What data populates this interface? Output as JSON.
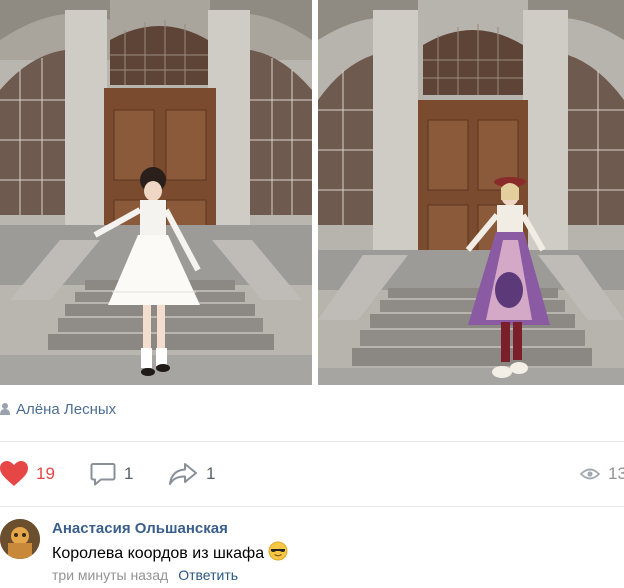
{
  "post": {
    "photos": [
      {
        "name": "photo-left"
      },
      {
        "name": "photo-right"
      }
    ],
    "author_name": "Алёна Лесных"
  },
  "actions": {
    "likes_count": "19",
    "comments_count": "1",
    "shares_count": "1",
    "views_count": "13",
    "like_color": "#e64646"
  },
  "comment": {
    "author": "Анастасия Ольшанская",
    "text": "Королева коордов из шкафа",
    "emoji": "😎",
    "time": "три минуты назад",
    "reply_label": "Ответить"
  },
  "icons": [
    "person-icon",
    "heart-icon",
    "comment-icon",
    "share-icon",
    "eye-icon",
    "sunglasses-emoji-icon"
  ]
}
